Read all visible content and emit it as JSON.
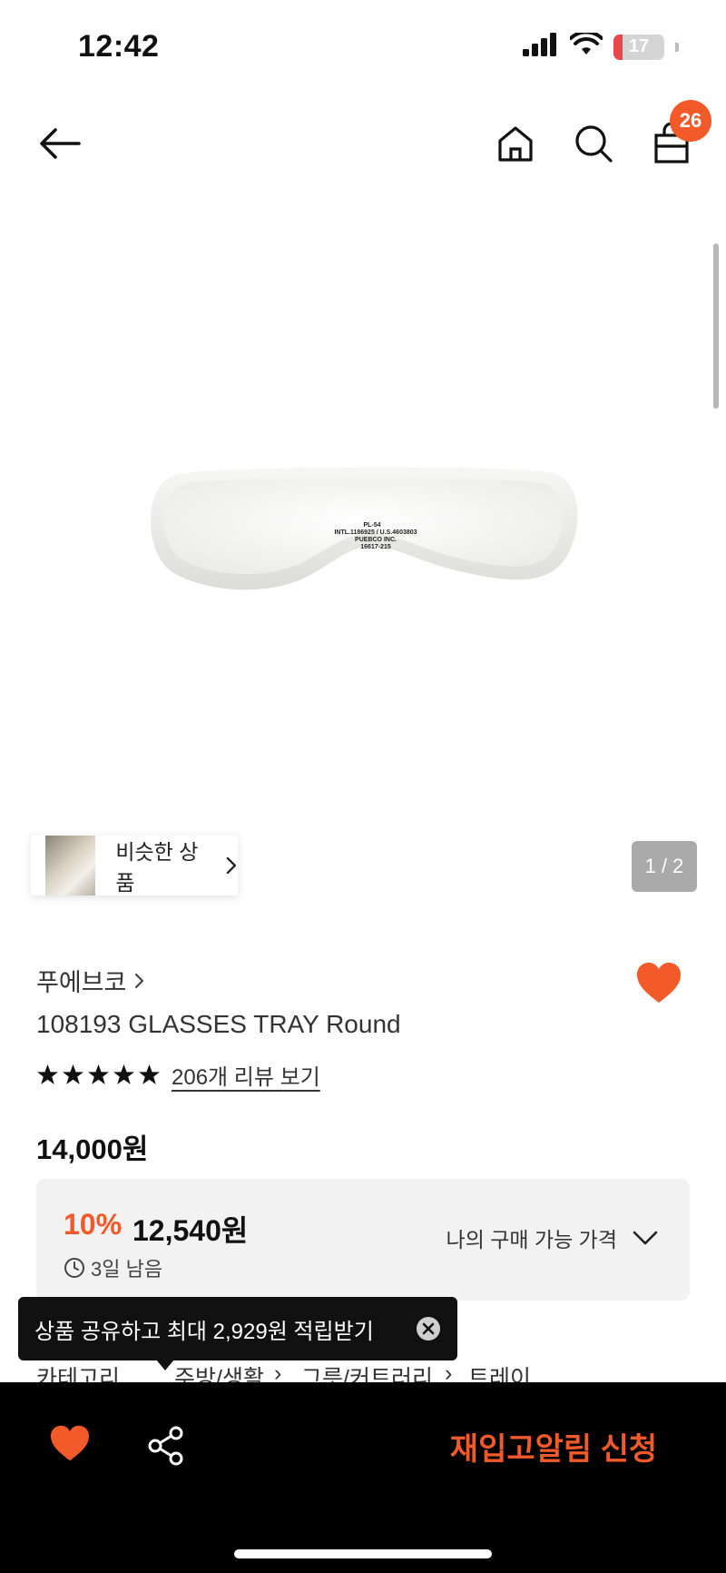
{
  "status_bar": {
    "time": "12:42",
    "battery_percent": "17",
    "battery_level": 0.17
  },
  "nav": {
    "cart_count": "26"
  },
  "gallery": {
    "similar_label": "비슷한 상품",
    "page_indicator": "1 / 2",
    "print_lines": [
      "PL-54",
      "INTL.1186925 / U.S.4603803",
      "PUEBCO INC.",
      "16617-215"
    ]
  },
  "product": {
    "brand": "푸에브코",
    "name": "108193 GLASSES TRAY Round",
    "rating_stars": 5,
    "review_link": "206개 리뷰 보기",
    "original_price": "14,000원"
  },
  "discount": {
    "rate": "10%",
    "price": "12,540원",
    "time_left": "3일 남음",
    "my_price_label": "나의 구매 가능 가격"
  },
  "tooltip": {
    "text": "상품 공유하고 최대 2,929원 적립받기"
  },
  "category": {
    "label": "카테고리",
    "path": [
      "주방/생활",
      "그릇/커트러리",
      "트레이"
    ]
  },
  "bottom_bar": {
    "restock_label": "재입고알림 신청"
  },
  "colors": {
    "accent": "#f25a29",
    "bottom_bar": "#000000",
    "discount_box": "#f2f2f2"
  }
}
